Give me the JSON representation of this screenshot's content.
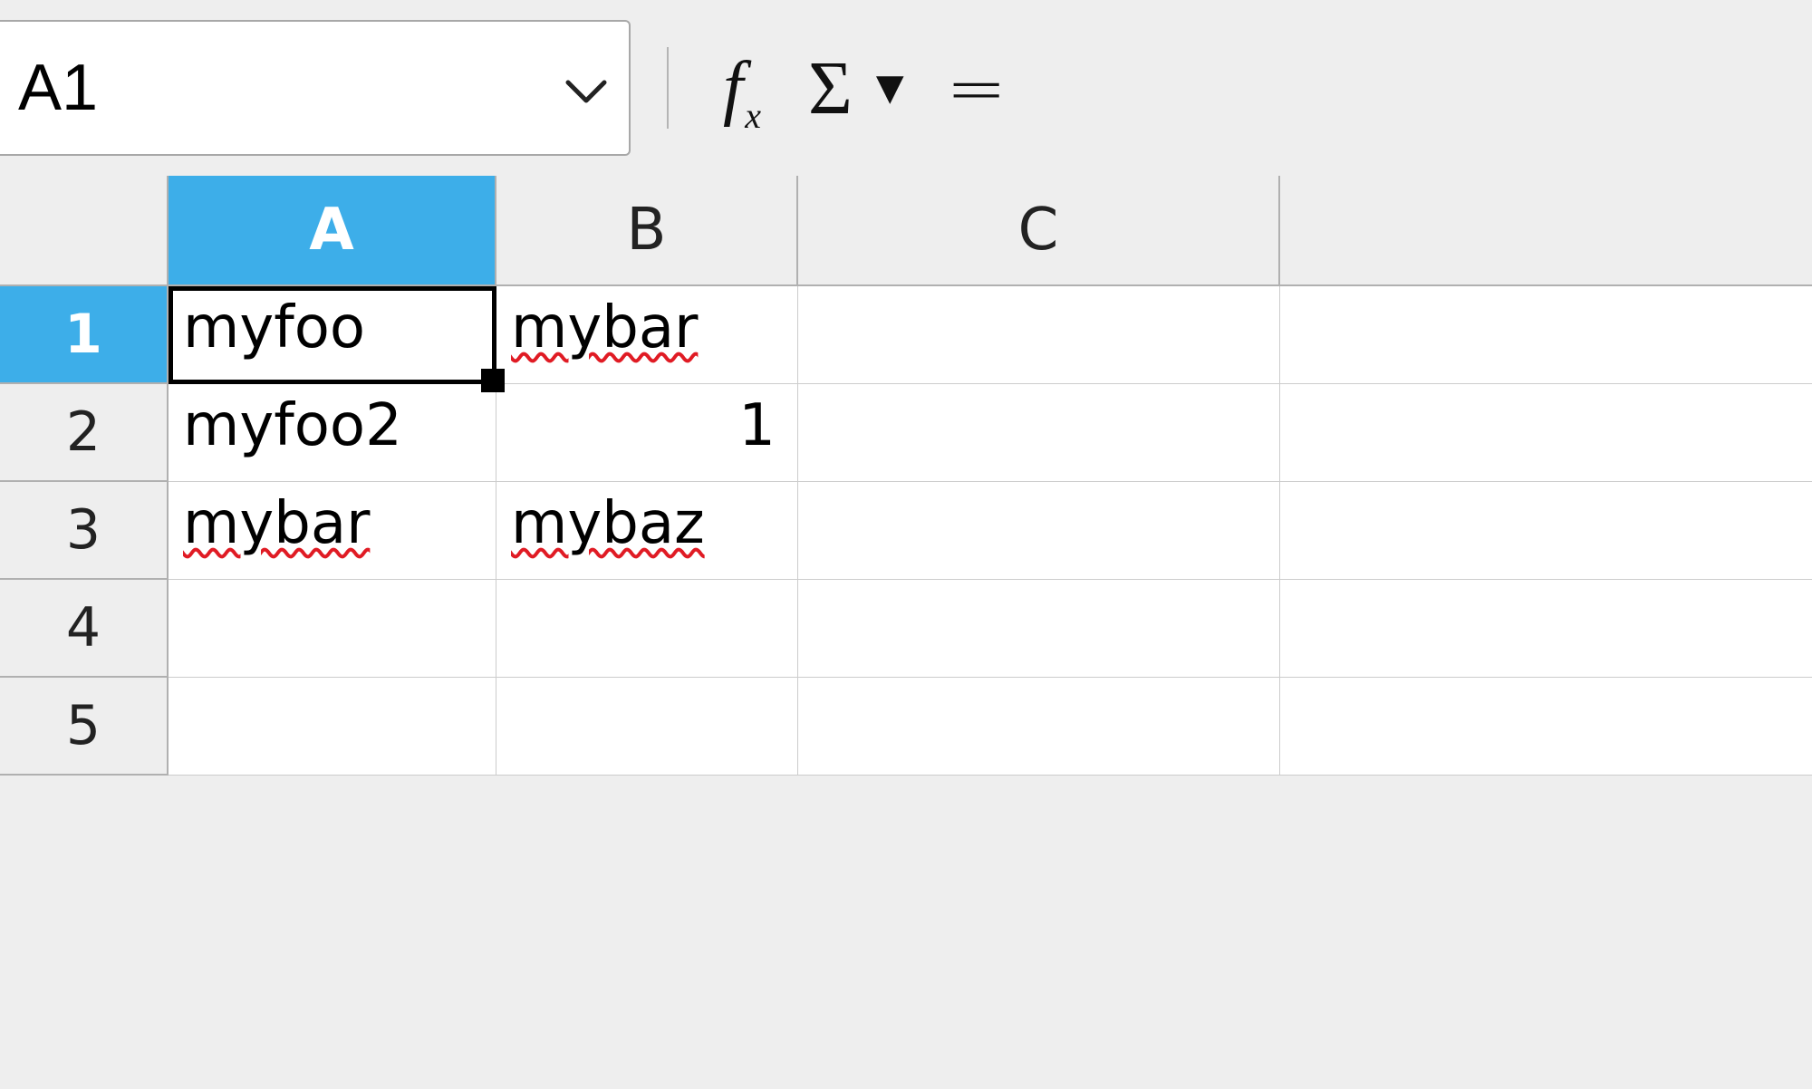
{
  "formula_bar": {
    "name_box_value": "A1",
    "buttons": {
      "fx_label": "f",
      "fx_sub": "x",
      "sigma_label": "Σ",
      "equals_label": "="
    }
  },
  "grid": {
    "columns": [
      "A",
      "B",
      "C"
    ],
    "selected_column": "A",
    "selected_row": 1,
    "active_cell": "A1",
    "rows": [
      {
        "n": 1,
        "cells": {
          "A": {
            "v": "myfoo",
            "spell": false
          },
          "B": {
            "v": "mybar",
            "spell": true
          },
          "C": {
            "v": "",
            "spell": false
          }
        }
      },
      {
        "n": 2,
        "cells": {
          "A": {
            "v": "myfoo2",
            "spell": false
          },
          "B": {
            "v": "1",
            "spell": false,
            "num": true
          },
          "C": {
            "v": "",
            "spell": false
          }
        }
      },
      {
        "n": 3,
        "cells": {
          "A": {
            "v": "mybar",
            "spell": true
          },
          "B": {
            "v": "mybaz",
            "spell": true
          },
          "C": {
            "v": "",
            "spell": false
          }
        }
      },
      {
        "n": 4,
        "cells": {
          "A": {
            "v": "",
            "spell": false
          },
          "B": {
            "v": "",
            "spell": false
          },
          "C": {
            "v": "",
            "spell": false
          }
        }
      },
      {
        "n": 5,
        "cells": {
          "A": {
            "v": "",
            "spell": false
          },
          "B": {
            "v": "",
            "spell": false
          },
          "C": {
            "v": "",
            "spell": false
          }
        }
      }
    ]
  }
}
